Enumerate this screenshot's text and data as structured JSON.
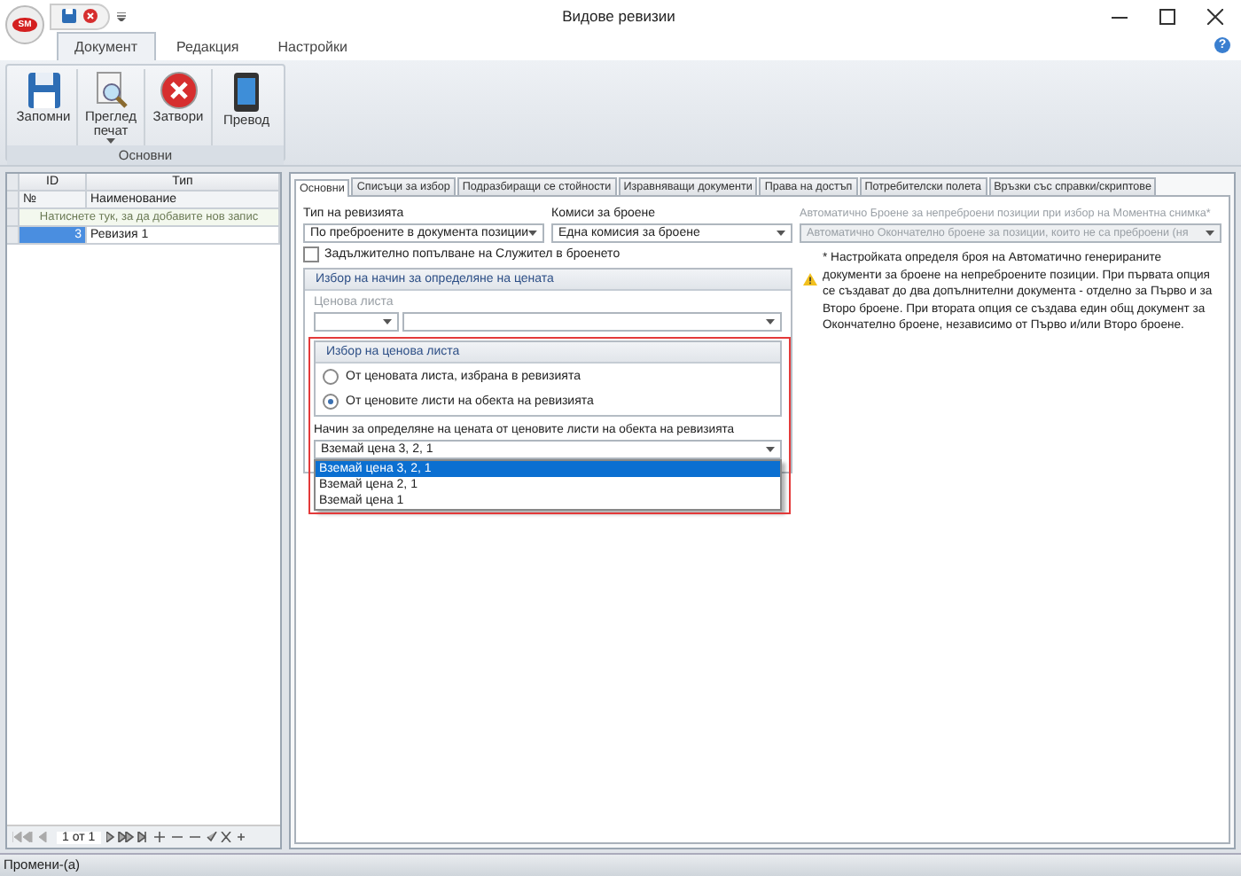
{
  "window": {
    "title": "Видове ревизии",
    "logo_text": "SM",
    "help": "?"
  },
  "ribbon": {
    "tabs": [
      {
        "label": "Документ",
        "selected": true
      },
      {
        "label": "Редакция",
        "selected": false
      },
      {
        "label": "Настройки",
        "selected": false
      }
    ],
    "groups": [
      {
        "label": "Основни",
        "buttons": [
          {
            "label": "Запомни",
            "kind": "save",
            "dropdown": false
          },
          {
            "label": "Преглед печат",
            "kind": "preview",
            "dropdown": true
          },
          {
            "label": "Затвори",
            "kind": "close",
            "dropdown": false
          },
          {
            "label": "Превод",
            "kind": "translate",
            "dropdown": false
          }
        ]
      }
    ]
  },
  "grid": {
    "columns": [
      "ID",
      "Тип"
    ],
    "subheaders": [
      "№",
      "Наименование"
    ],
    "new_row_hint": "Натиснете тук, за да добавите нов запис",
    "rows": [
      {
        "id": "3",
        "name": "Ревизия 1",
        "selected": true
      }
    ],
    "navigator": {
      "position": "1 от 1"
    }
  },
  "tabs": [
    {
      "label": "Основни",
      "selected": true
    },
    {
      "label": "Списъци за избор",
      "selected": false
    },
    {
      "label": "Подразбиращи се стойности",
      "selected": false
    },
    {
      "label": "Изравняващи документи",
      "selected": false
    },
    {
      "label": "Права на достъп",
      "selected": false
    },
    {
      "label": "Потребителски полета",
      "selected": false
    },
    {
      "label": "Връзки със справки/скриптове",
      "selected": false
    }
  ],
  "form": {
    "fields": [
      {
        "label": "Тип на ревизията",
        "value": "По преброените в документа позиции",
        "disabled": false
      },
      {
        "label": "Комиси за броене",
        "value": "Една комисия за броене",
        "disabled": false
      },
      {
        "label": "Автоматично Броене за непреброени позиции при избор на Моментна снимка*",
        "value": "Автоматично Окончателно броене за позиции, които не са преброени (ня",
        "disabled": true
      }
    ],
    "checkbox": {
      "label": "Задължително попълване на Служител в броенето",
      "checked": false
    },
    "price_group": {
      "title": "Избор на начин за определяне на цената",
      "price_list_label": "Ценова листа",
      "selection_title": "Избор на ценова листа",
      "options": [
        {
          "label": "От ценовата листа, избрана в ревизията",
          "selected": false
        },
        {
          "label": "От ценовите листи на обекта на ревизията",
          "selected": true
        }
      ],
      "method_label": "Начин за определяне на цената от ценовите листи на обекта на ревизията",
      "method_value": "Вземай цена 3, 2, 1",
      "dropdown_items": [
        {
          "label": "Вземай цена 3, 2, 1",
          "selected": true
        },
        {
          "label": "Вземай цена 2, 1",
          "selected": false
        },
        {
          "label": "Вземай цена 1",
          "selected": false
        }
      ]
    },
    "note": "* Настройката определя броя на Автоматично генерираните документи за броене на непреброените позиции. При първата опция се създават до два допълнителни документа - отделно за Първо и за Второ броене. При втората опция се създава един общ документ за Окончателно броене, независимо от Първо и/или Второ броене."
  },
  "status_bar": "Промени-(а)"
}
